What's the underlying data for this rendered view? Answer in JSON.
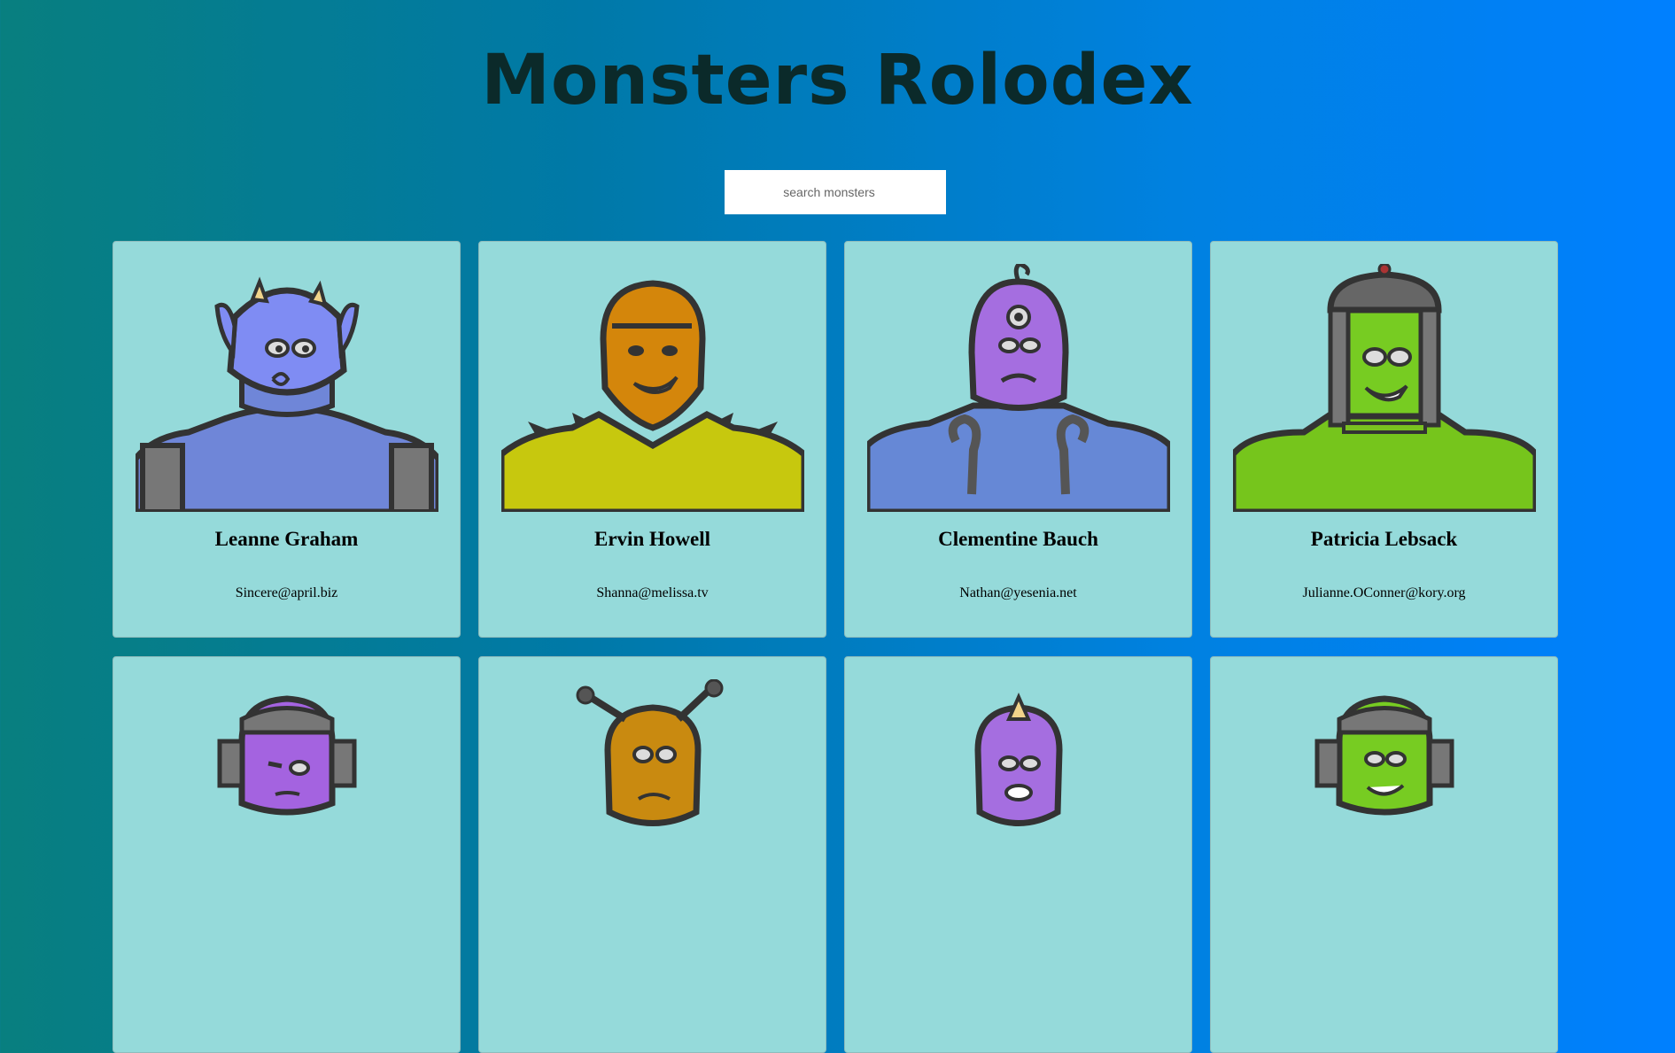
{
  "app": {
    "title": "Monsters Rolodex"
  },
  "search": {
    "placeholder": "search monsters"
  },
  "monsters": [
    {
      "name": "Leanne Graham",
      "email": "Sincere@april.biz",
      "icon": "blue-horned-monster-icon",
      "skin": "#7f8cf3",
      "body": "#6f86d8"
    },
    {
      "name": "Ervin Howell",
      "email": "Shanna@melissa.tv",
      "icon": "orange-smiling-monster-icon",
      "skin": "#d4860b",
      "body": "#c7c80e"
    },
    {
      "name": "Clementine Bauch",
      "email": "Nathan@yesenia.net",
      "icon": "purple-cyclops-monster-icon",
      "skin": "#a56ee0",
      "body": "#6688d6"
    },
    {
      "name": "Patricia Lebsack",
      "email": "Julianne.OConner@kory.org",
      "icon": "green-robot-helmet-monster-icon",
      "skin": "#77cc22",
      "body": "#76c51c"
    },
    {
      "name": "",
      "email": "",
      "icon": "purple-helmet-monster-icon",
      "skin": "#a463e0",
      "body": "#a463e0"
    },
    {
      "name": "",
      "email": "",
      "icon": "orange-antenna-monster-icon",
      "skin": "#c98a10",
      "body": "#c98a10"
    },
    {
      "name": "",
      "email": "",
      "icon": "purple-horned-monster-icon",
      "skin": "#a56ee0",
      "body": "#a56ee0"
    },
    {
      "name": "",
      "email": "",
      "icon": "green-helmet-monster-icon",
      "skin": "#77cc22",
      "body": "#77cc22"
    }
  ]
}
